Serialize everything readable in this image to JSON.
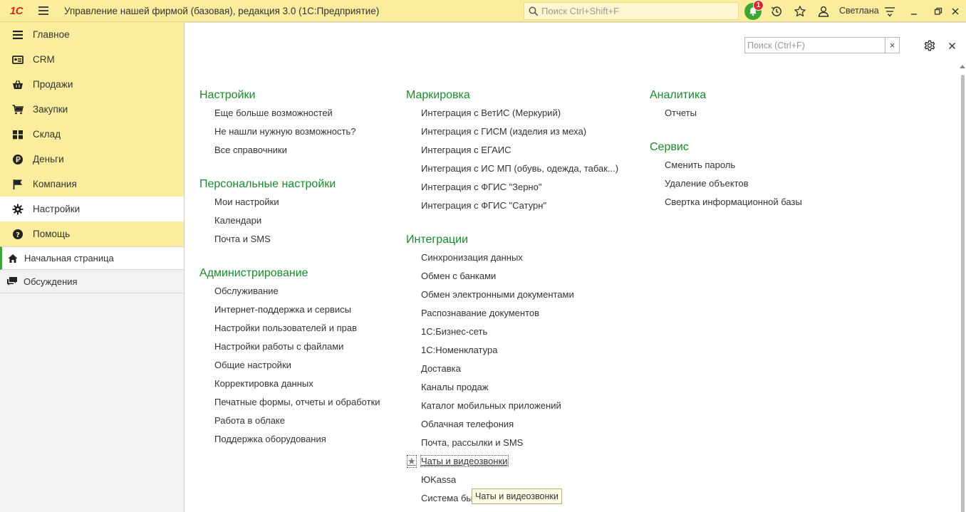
{
  "topbar": {
    "logo": "1С",
    "title": "Управление нашей фирмой (базовая), редакция 3.0  (1С:Предприятие)",
    "search_placeholder": "Поиск Ctrl+Shift+F",
    "notifications_count": "1",
    "user": "Светлана"
  },
  "sidebar": {
    "sections": [
      {
        "label": "Главное",
        "icon": "list-icon"
      },
      {
        "label": "CRM",
        "icon": "crm-icon"
      },
      {
        "label": "Продажи",
        "icon": "basket-icon"
      },
      {
        "label": "Закупки",
        "icon": "cart-icon"
      },
      {
        "label": "Склад",
        "icon": "warehouse-icon"
      },
      {
        "label": "Деньги",
        "icon": "money-icon"
      },
      {
        "label": "Компания",
        "icon": "flag-icon"
      },
      {
        "label": "Настройки",
        "icon": "gear-icon"
      },
      {
        "label": "Помощь",
        "icon": "help-icon"
      }
    ],
    "favorites": [
      {
        "label": "Начальная страница",
        "icon": "home-icon"
      },
      {
        "label": "Обсуждения",
        "icon": "chat-icon"
      }
    ]
  },
  "main": {
    "search_placeholder": "Поиск (Ctrl+F)",
    "columns": [
      [
        {
          "title": "Настройки",
          "items": [
            "Еще больше возможностей",
            "Не нашли нужную возможность?",
            "Все справочники"
          ]
        },
        {
          "title": "Персональные настройки",
          "items": [
            "Мои настройки",
            "Календари",
            "Почта и SMS"
          ]
        },
        {
          "title": "Администрирование",
          "items": [
            "Обслуживание",
            "Интернет-поддержка и сервисы",
            "Настройки пользователей и прав",
            "Настройки работы с файлами",
            "Общие настройки",
            "Корректировка данных",
            "Печатные формы, отчеты и обработки",
            "Работа в облаке",
            "Поддержка оборудования"
          ]
        }
      ],
      [
        {
          "title": "Маркировка",
          "items": [
            "Интеграция с ВетИС (Меркурий)",
            "Интеграция с ГИСМ (изделия из меха)",
            "Интеграция с ЕГАИС",
            "Интеграция с ИС МП (обувь, одежда, табак...)",
            "Интеграция с ФГИС \"Зерно\"",
            "Интеграция с ФГИС \"Сатурн\""
          ]
        },
        {
          "title": "Интеграции",
          "items": [
            "Синхронизация данных",
            "Обмен с банками",
            "Обмен электронными документами",
            "Распознавание документов",
            "1С:Бизнес-сеть",
            "1С:Номенклатура",
            "Доставка",
            "Каналы продаж",
            "Каталог мобильных приложений",
            "Облачная телефония",
            "Почта, рассылки и SMS",
            "Чаты и видеозвонки",
            "ЮKassa",
            "Система быстрых платежей"
          ]
        }
      ],
      [
        {
          "title": "Аналитика",
          "items": [
            "Отчеты"
          ]
        },
        {
          "title": "Сервис",
          "items": [
            "Сменить пароль",
            "Удаление объектов",
            "Свертка информационной базы"
          ]
        }
      ]
    ],
    "tooltip": "Чаты и видеозвонки"
  }
}
